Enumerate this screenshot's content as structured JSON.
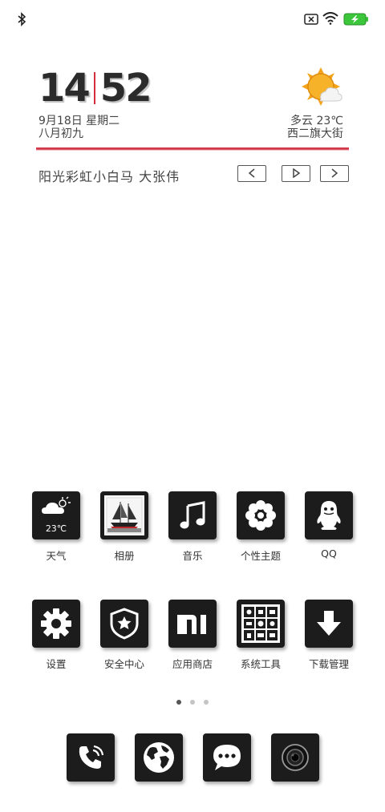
{
  "status_bar": {
    "icons": [
      "bluetooth-icon",
      "sim-missing-icon",
      "wifi-icon",
      "battery-charging-icon"
    ],
    "battery_color": "#3cc63c"
  },
  "clock_widget": {
    "hours": "14",
    "minutes": "52",
    "date": "9月18日 星期二",
    "lunar_date": "八月初九",
    "accent_color": "#d32f3c"
  },
  "weather_widget": {
    "icon": "partly-cloudy-sun-icon",
    "condition_temp": "多云 23℃",
    "location": "西二旗大街"
  },
  "music_widget": {
    "track": "阳光彩虹小白马   大张伟",
    "controls": [
      "previous",
      "play",
      "next"
    ]
  },
  "apps_row1": [
    {
      "label": "天气",
      "icon": "weather-icon",
      "tile_text": "23℃"
    },
    {
      "label": "相册",
      "icon": "gallery-icon"
    },
    {
      "label": "音乐",
      "icon": "music-note-icon"
    },
    {
      "label": "个性主题",
      "icon": "theme-flower-icon"
    },
    {
      "label": "QQ",
      "icon": "qq-penguin-icon"
    }
  ],
  "apps_row2": [
    {
      "label": "设置",
      "icon": "gear-icon"
    },
    {
      "label": "安全中心",
      "icon": "shield-star-icon"
    },
    {
      "label": "应用商店",
      "icon": "mi-store-icon",
      "tile_text": "mi"
    },
    {
      "label": "系统工具",
      "icon": "tools-grid-icon"
    },
    {
      "label": "下载管理",
      "icon": "download-arrow-icon"
    }
  ],
  "page_indicator": {
    "pages": 3,
    "current": 1
  },
  "dock": [
    {
      "icon": "phone-icon"
    },
    {
      "icon": "browser-globe-icon"
    },
    {
      "icon": "messages-icon"
    },
    {
      "icon": "camera-icon"
    }
  ]
}
